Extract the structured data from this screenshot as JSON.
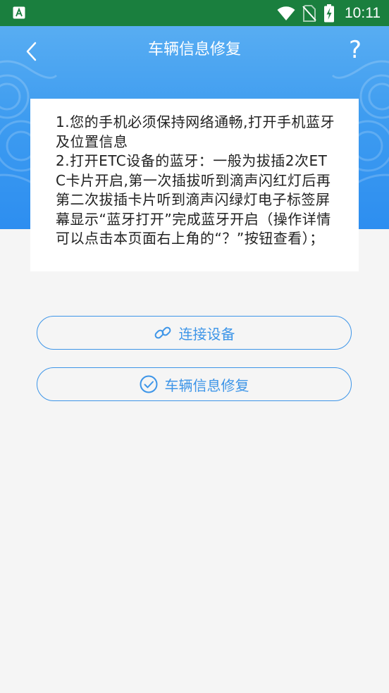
{
  "status_bar": {
    "time": "10:11",
    "left_icon": "app-a-icon",
    "icons": [
      "wifi-icon",
      "no-sim-icon",
      "battery-charging-icon"
    ]
  },
  "header": {
    "title": "车辆信息修复",
    "back_icon": "chevron-left-icon",
    "help_label": "?"
  },
  "instructions": {
    "text": "1.您的手机必须保持网络通畅,打开手机蓝牙及位置信息\n2.打开ETC设备的蓝牙：一般为拔插2次ETC卡片开启,第一次插拔听到滴声闪红灯后再第二次拔插卡片听到滴声闪绿灯电子标签屏幕显示“蓝牙打开”完成蓝牙开启（操作详情可以点击本页面右上角的“？”按钮查看）；"
  },
  "actions": {
    "connect_label": "连接设备",
    "connect_icon": "link-icon",
    "repair_label": "车辆信息修复",
    "repair_icon": "check-circle-icon"
  },
  "colors": {
    "status_bar": "#1a7f3e",
    "header_top": "#58adf2",
    "header_bottom": "#2d8ef0",
    "accent": "#3d95e8",
    "background": "#f5f5f5"
  }
}
